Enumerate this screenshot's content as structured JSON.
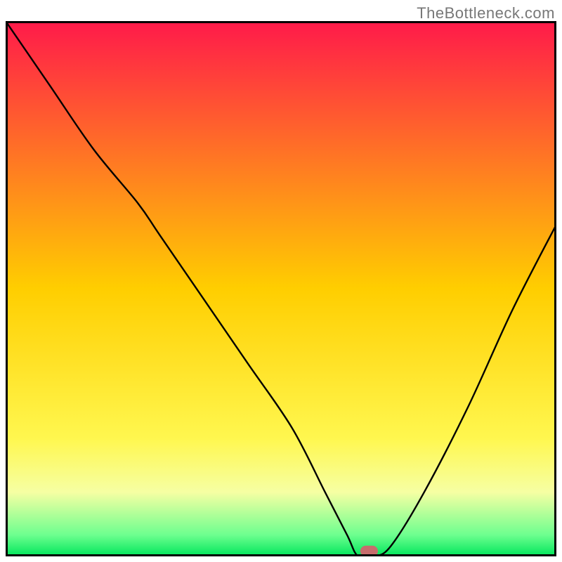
{
  "watermark": "TheBottleneck.com",
  "chart_data": {
    "type": "line",
    "title": "",
    "xlabel": "",
    "ylabel": "",
    "xlim": [
      0,
      100
    ],
    "ylim": [
      0,
      100
    ],
    "grid": false,
    "legend": false,
    "annotations": [],
    "gradient_stops": [
      {
        "offset": 0,
        "color": "#ff1a4a"
      },
      {
        "offset": 50,
        "color": "#ffce00"
      },
      {
        "offset": 78,
        "color": "#fff74f"
      },
      {
        "offset": 88,
        "color": "#f6ffa3"
      },
      {
        "offset": 96,
        "color": "#6dff8f"
      },
      {
        "offset": 100,
        "color": "#00e55b"
      }
    ],
    "series": [
      {
        "name": "bottleneck-curve",
        "x": [
          0,
          8,
          16,
          24,
          28,
          36,
          44,
          52,
          58,
          62,
          64,
          67,
          70,
          76,
          84,
          92,
          100
        ],
        "y": [
          100,
          88,
          76,
          66,
          60,
          48,
          36,
          24,
          12,
          4,
          0,
          0,
          2,
          12,
          28,
          46,
          62
        ]
      }
    ],
    "marker": {
      "x": 66,
      "y": 1,
      "w": 3.2,
      "h": 2.0,
      "color": "#c76d6d"
    }
  }
}
